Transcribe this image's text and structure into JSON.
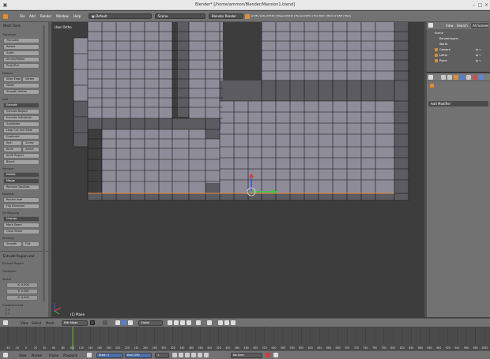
{
  "window": {
    "title": "Blender* [/home/ammon/Blender/Mansion1.blend]"
  },
  "info_header": {
    "menus": [
      "File",
      "Add",
      "Render",
      "Window",
      "Help"
    ],
    "layout": "Default",
    "scene": "Scene",
    "engine": "Blender Render",
    "stats": "v2.78 | Verts:2/2193 | Edges:0/4141 | Faces:0/1951 | Tris:3912 | Mem:22.28M | Plane"
  },
  "tool_shelf": {
    "sections": [
      {
        "title": "Mesh Tools",
        "items": []
      },
      {
        "title": "Transform",
        "items": [
          "Translate",
          "Rotate",
          "Scale",
          "Shrink/Fatten",
          "Push/Pull"
        ]
      },
      {
        "title": "Deform",
        "items": [
          "Slide Edge",
          "Vertex",
          "Noise",
          "Smooth Vertex",
          "Add"
        ]
      },
      {
        "title": "",
        "items": [
          "Extrude",
          "Extrude Region",
          "Extrude Individual",
          "Subdivide",
          "Loop Cut and Slide",
          "Duplicate",
          "Spin",
          "Screw",
          "Knife",
          "Select",
          "Knife Project",
          "Bisect"
        ]
      },
      {
        "title": "Remove",
        "items": [
          "Delete",
          "Merge",
          "Remove Doubles"
        ]
      },
      {
        "title": "Normals",
        "items": [
          "Recalculate",
          "Flip Direction"
        ]
      },
      {
        "title": "UV Mapping",
        "items": [
          "Unwrap",
          "Mark Seam",
          "Clear Seam"
        ]
      },
      {
        "title": "Shading",
        "items": [
          "Smooth",
          "Flat"
        ]
      },
      {
        "title": "Extrude Region and",
        "items": []
      },
      {
        "title": "Extrude Region",
        "items": [
          "Transform"
        ]
      },
      {
        "title": "Vector",
        "items": [
          "X: 0.000",
          "Y: 0.000",
          "Z: 0.000"
        ]
      },
      {
        "title": "Constraint Axis",
        "items": [
          "X",
          "Y",
          "Z"
        ]
      }
    ]
  },
  "viewport": {
    "view_label": "User Ortho",
    "object_label": "(1) Plane"
  },
  "outliner": {
    "header": [
      "View",
      "Search",
      "All Scenes"
    ],
    "rows": [
      "Scene",
      "RenderLayers",
      "World",
      "Camera",
      "Lamp",
      "Plane"
    ]
  },
  "properties": {
    "add_modifier": "Add Modifier"
  },
  "view3d_header": {
    "menus": [
      "View",
      "Select",
      "Mesh"
    ],
    "mode": "Edit Mode",
    "orientation": "Global"
  },
  "timeline": {
    "ticks": [
      "-40",
      "-20",
      "0",
      "20",
      "40",
      "60",
      "80",
      "100",
      "120",
      "140",
      "160",
      "180",
      "200",
      "220",
      "240",
      "260",
      "280",
      "300",
      "320",
      "340",
      "360",
      "380",
      "400",
      "420",
      "440",
      "460",
      "480",
      "500",
      "520",
      "540",
      "560",
      "580",
      "600",
      "620",
      "640",
      "660",
      "680",
      "700",
      "720",
      "740",
      "760",
      "780",
      "800",
      "820",
      "840",
      "860",
      "880",
      "900",
      "920",
      "940",
      "960",
      "980",
      "1000"
    ],
    "menus": [
      "View",
      "Marker",
      "Frame",
      "Playback"
    ],
    "start": "Start: 1",
    "end": "End: 250",
    "current": "1",
    "sync": "No Sync"
  },
  "colors": {
    "panel": "#727272",
    "viewport_bg": "#3d3d3d",
    "face": "#8e8c98",
    "face_dark": "#5b5b61",
    "edge": "#111111",
    "playhead": "#64c832",
    "selected_edge": "#e08a3c"
  }
}
